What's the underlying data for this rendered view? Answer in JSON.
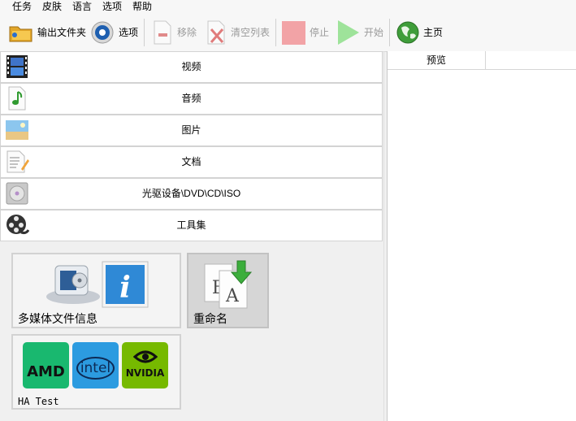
{
  "menu": [
    "任务",
    "皮肤",
    "语言",
    "选项",
    "帮助"
  ],
  "toolbar": {
    "output_folder": "输出文件夹",
    "options": "选项",
    "remove": "移除",
    "clear_list": "清空列表",
    "stop": "停止",
    "start": "开始",
    "home": "主页"
  },
  "categories": [
    {
      "label": "视频",
      "icon": "film-icon"
    },
    {
      "label": "音频",
      "icon": "music-note-icon"
    },
    {
      "label": "图片",
      "icon": "picture-icon"
    },
    {
      "label": "文档",
      "icon": "document-icon"
    },
    {
      "label": "光驱设备\\DVD\\CD\\ISO",
      "icon": "disc-drive-icon"
    },
    {
      "label": "工具集",
      "icon": "film-reel-icon"
    }
  ],
  "tools": {
    "media_info": "多媒体文件信息",
    "rename": "重命名",
    "ha_test": "HA Test",
    "amd": "AMD",
    "intel": "intel",
    "nvidia": "NVIDIA"
  },
  "preview": {
    "column": "预览"
  }
}
